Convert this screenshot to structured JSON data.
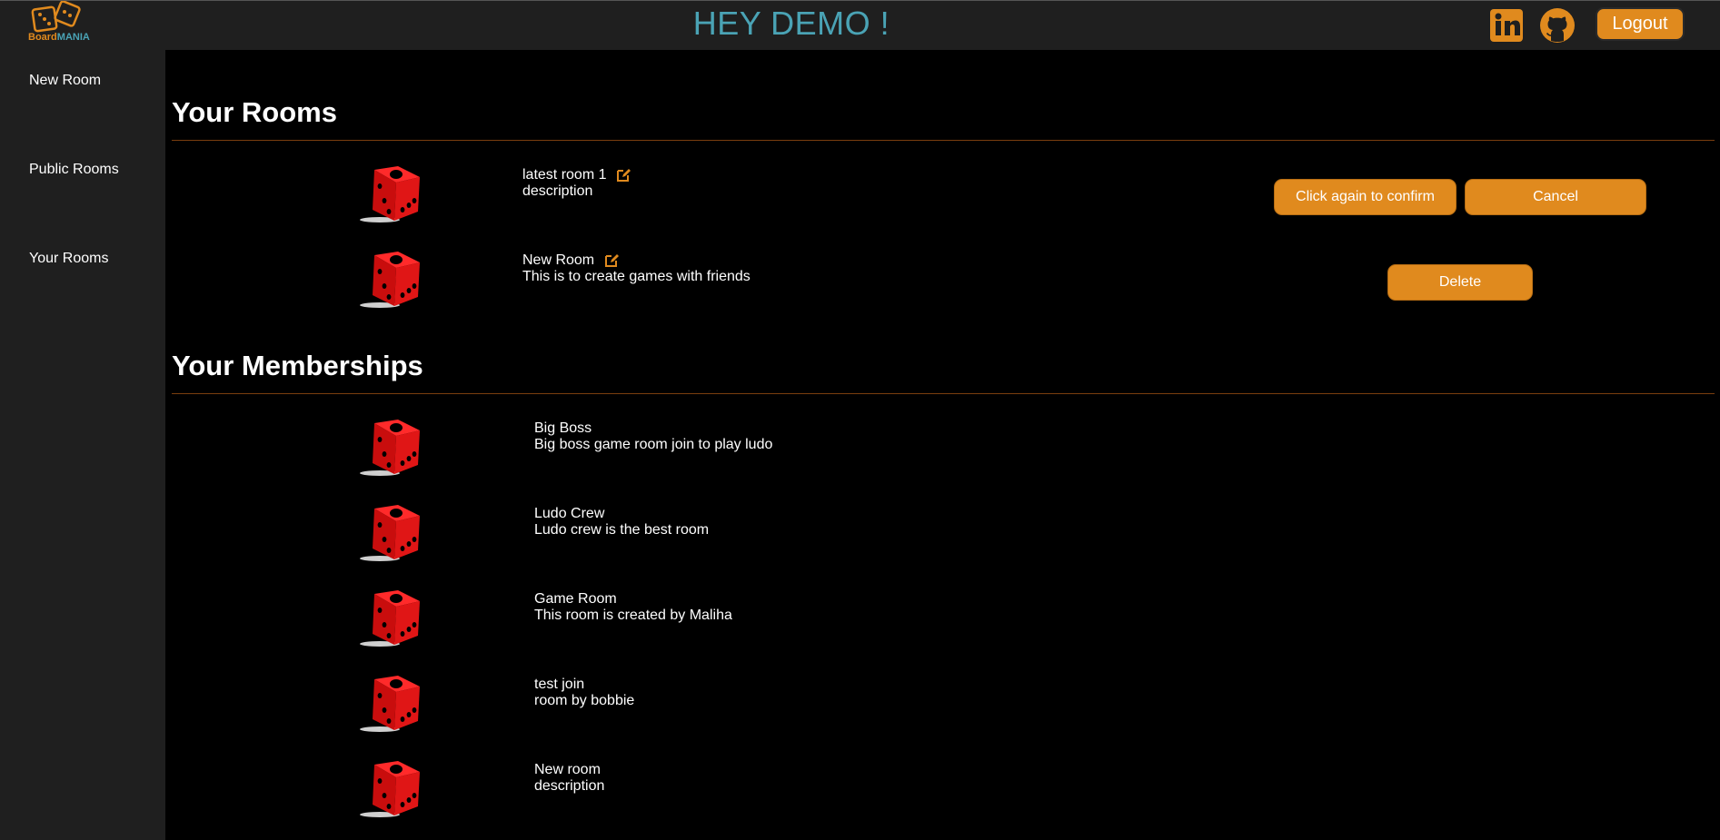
{
  "app": {
    "logo": {
      "part1": "Board",
      "part2": "MANIA"
    },
    "greeting": "HEY DEMO !",
    "logout_label": "Logout",
    "accent_color": "#e08a1e",
    "greeting_color": "#4aa3b5"
  },
  "sidebar": {
    "items": [
      {
        "label": "New Room"
      },
      {
        "label": "Public Rooms"
      },
      {
        "label": "Your Rooms"
      }
    ]
  },
  "your_rooms": {
    "title": "Your Rooms",
    "rooms": [
      {
        "name": "latest room 1",
        "description": "description",
        "confirm_label": "Click again to confirm",
        "cancel_label": "Cancel"
      },
      {
        "name": "New Room",
        "description": "This is to create games with friends",
        "delete_label": "Delete"
      }
    ]
  },
  "memberships": {
    "title": "Your Memberships",
    "rooms": [
      {
        "name": "Big Boss",
        "description": "Big boss game room join to play ludo"
      },
      {
        "name": "Ludo Crew",
        "description": "Ludo crew is the best room"
      },
      {
        "name": "Game Room",
        "description": "This room is created by Maliha"
      },
      {
        "name": "test join",
        "description": "room by bobbie"
      },
      {
        "name": "New room",
        "description": "description"
      }
    ]
  },
  "icons": {
    "logo": "dice-logo-icon",
    "linkedin": "linkedin-icon",
    "github": "github-icon",
    "edit": "edit-icon",
    "room": "red-die-icon"
  }
}
